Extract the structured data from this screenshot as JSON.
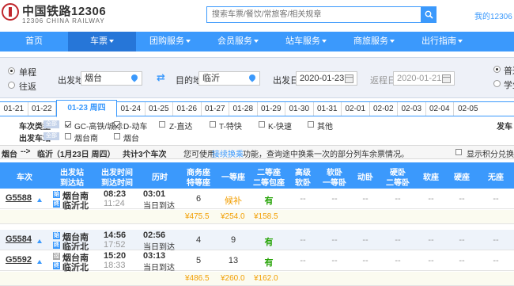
{
  "header": {
    "logo_title": "中国铁路12306",
    "logo_sub": "12306 CHINA RAILWAY",
    "search_placeholder": "搜索车票/餐饮/常旅客/相关规章",
    "my_link": "我的12306"
  },
  "nav": {
    "items": [
      {
        "label": "首页",
        "dropdown": false,
        "active": false
      },
      {
        "label": "车票",
        "dropdown": true,
        "active": true
      },
      {
        "label": "团购服务",
        "dropdown": true,
        "active": false
      },
      {
        "label": "会员服务",
        "dropdown": true,
        "active": false
      },
      {
        "label": "站车服务",
        "dropdown": true,
        "active": false
      },
      {
        "label": "商旅服务",
        "dropdown": true,
        "active": false
      },
      {
        "label": "出行指南",
        "dropdown": true,
        "active": false
      }
    ]
  },
  "query": {
    "oneway_label": "单程",
    "roundtrip_label": "往返",
    "trip_type_selected": "单程",
    "from_label": "出发地",
    "from_value": "烟台",
    "to_label": "目的地",
    "to_value": "临沂",
    "depart_label": "出发日",
    "depart_value": "2020-01-23",
    "return_label": "返程日",
    "return_value": "2020-01-21",
    "ticket_normal": "普通",
    "ticket_student": "学生",
    "ticket_selected": "普通"
  },
  "date_tabs": [
    "01-21",
    "01-22",
    "01-23 周四",
    "01-24",
    "01-25",
    "01-26",
    "01-27",
    "01-28",
    "01-29",
    "01-30",
    "01-31",
    "02-01",
    "02-02",
    "02-03",
    "02-04",
    "02-05"
  ],
  "date_active": "01-23 周四",
  "filters": {
    "train_type_label": "车次类型",
    "all_badge": "全部",
    "train_types": [
      {
        "label": "GC-高铁/城际",
        "checked": true
      },
      {
        "label": "D-动车",
        "checked": true
      },
      {
        "label": "Z-直达",
        "checked": false
      },
      {
        "label": "T-特快",
        "checked": false
      },
      {
        "label": "K-快速",
        "checked": false
      },
      {
        "label": "其他",
        "checked": false
      }
    ],
    "depart_station_label": "出发车站",
    "depart_stations": [
      {
        "label": "烟台南",
        "checked": false
      },
      {
        "label": "烟台",
        "checked": false
      }
    ],
    "depart_time_label": "发车"
  },
  "route": {
    "from": "烟台",
    "arrow": "-->",
    "to": "临沂",
    "date_text": "（1月23日  周四）",
    "count_text": "共计3个车次",
    "tip_prefix": "您可使用",
    "tip_link": "接续换乘",
    "tip_suffix": "功能，查询途中换乘一次的部分列车余票情况。",
    "points_label": "显示积分兑换"
  },
  "table": {
    "headers": [
      {
        "l1": "车次",
        "l2": ""
      },
      {
        "l1": "出发站",
        "l2": "到达站"
      },
      {
        "l1": "出发时间",
        "l2": "到达时间"
      },
      {
        "l1": "历时",
        "l2": ""
      },
      {
        "l1": "商务座",
        "l2": "特等座"
      },
      {
        "l1": "一等座",
        "l2": ""
      },
      {
        "l1": "二等座",
        "l2": "二等包座"
      },
      {
        "l1": "高级",
        "l2": "软卧"
      },
      {
        "l1": "软卧",
        "l2": "一等卧"
      },
      {
        "l1": "动卧",
        "l2": ""
      },
      {
        "l1": "硬卧",
        "l2": "二等卧"
      },
      {
        "l1": "软座",
        "l2": ""
      },
      {
        "l1": "硬座",
        "l2": ""
      },
      {
        "l1": "无座",
        "l2": ""
      }
    ],
    "rows": [
      {
        "train": "G5588",
        "from_badge": "始",
        "from": "烟台南",
        "to_badge": "终",
        "to": "临沂北",
        "depart": "08:23",
        "arrive": "11:24",
        "duration": "03:01",
        "duration_note": "当日到达",
        "business": "6",
        "first": "候补",
        "second": "有",
        "rest": [
          "--",
          "--",
          "--",
          "--",
          "--",
          "--",
          "--"
        ],
        "prices": [
          "¥475.5",
          "¥254.0",
          "¥158.5"
        ]
      },
      {
        "train": "G5584",
        "from_badge": "始",
        "from": "烟台南",
        "to_badge": "终",
        "to": "临沂北",
        "depart": "14:56",
        "arrive": "17:52",
        "duration": "02:56",
        "duration_note": "当日到达",
        "business": "4",
        "first": "9",
        "second": "有",
        "rest": [
          "--",
          "--",
          "--",
          "--",
          "--",
          "--",
          "--"
        ],
        "prices": []
      },
      {
        "train": "G5592",
        "from_badge": "过",
        "from": "烟台南",
        "to_badge": "终",
        "to": "临沂北",
        "depart": "15:20",
        "arrive": "18:33",
        "duration": "03:13",
        "duration_note": "当日到达",
        "business": "5",
        "first": "13",
        "second": "有",
        "rest": [
          "--",
          "--",
          "--",
          "--",
          "--",
          "--",
          "--"
        ],
        "prices": [
          "¥486.5",
          "¥260.0",
          "¥162.0"
        ]
      }
    ]
  },
  "colors": {
    "accent": "#3b99fc",
    "nav_active": "#2676d8",
    "available_green": "#26a306",
    "price_orange": "#f29e00",
    "brand_red": "#c0272d"
  }
}
